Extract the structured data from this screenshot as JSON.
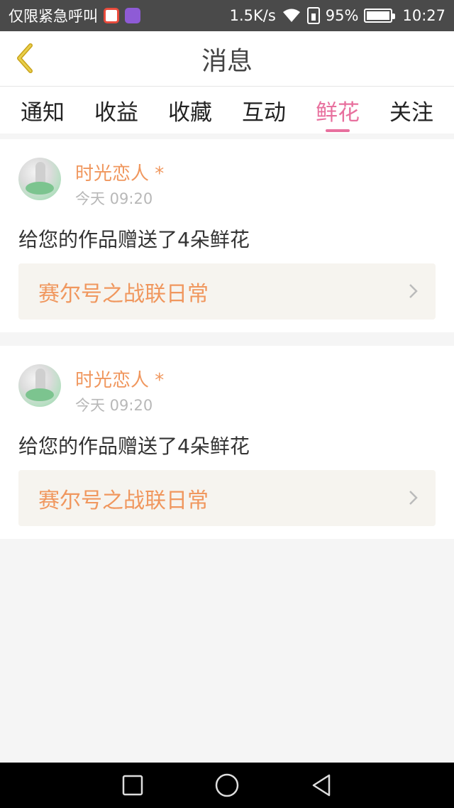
{
  "status_bar": {
    "left_text": "仅限紧急呼叫",
    "speed": "1.5K/s",
    "battery": "95%",
    "time": "10:27"
  },
  "header": {
    "title": "消息"
  },
  "tabs": [
    {
      "label": "通知"
    },
    {
      "label": "收益"
    },
    {
      "label": "收藏"
    },
    {
      "label": "互动"
    },
    {
      "label": "鲜花",
      "active": true
    },
    {
      "label": "关注"
    }
  ],
  "messages": [
    {
      "user": "时光恋人 *",
      "time": "今天 09:20",
      "text": "给您的作品赠送了4朵鲜花",
      "work": "赛尔号之战联日常"
    },
    {
      "user": "时光恋人 *",
      "time": "今天 09:20",
      "text": "给您的作品赠送了4朵鲜花",
      "work": "赛尔号之战联日常"
    }
  ],
  "colors": {
    "accent_pink": "#e8709e",
    "accent_orange": "#f0975e",
    "back_icon": "#c9a21a"
  },
  "icons": [
    "back-arrow-icon",
    "wifi-icon",
    "sim-icon",
    "battery-icon",
    "chevron-right-icon",
    "square-nav-icon",
    "circle-nav-icon",
    "triangle-nav-icon"
  ]
}
